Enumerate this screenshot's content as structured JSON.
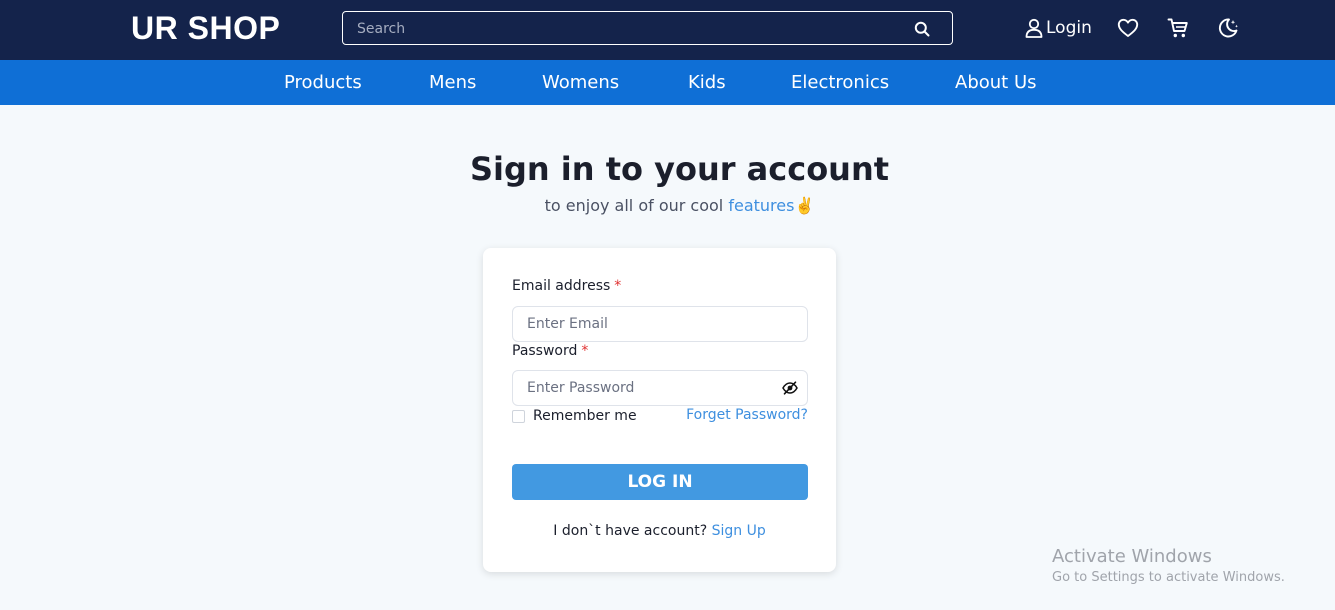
{
  "header": {
    "brand": "UR SHOP",
    "search_placeholder": "Search",
    "login_label": "Login"
  },
  "nav": {
    "items": [
      "Products",
      "Mens",
      "Womens",
      "Kids",
      "Electronics",
      "About Us"
    ]
  },
  "hero": {
    "title": "Sign in to your account",
    "subtitle_prefix": "to enjoy all of our cool",
    "subtitle_link": "features",
    "subtitle_emoji": "✌️"
  },
  "form": {
    "email_label": "Email address",
    "email_placeholder": "Enter Email",
    "password_label": "Password",
    "password_placeholder": "Enter Password",
    "required_marker": "*",
    "remember_label": "Remember me",
    "forgot_label": "Forget Password?",
    "submit_label": "LOG IN",
    "signup_prompt": "I don`t have account?",
    "signup_link": "Sign Up"
  },
  "watermark": {
    "line1": "Activate Windows",
    "line2": "Go to Settings to activate Windows."
  },
  "colors": {
    "header_bg": "#14234b",
    "nav_bg": "#0f6fd6",
    "accent": "#3e8fdf",
    "button_bg": "#4299e1",
    "required": "#e03131"
  }
}
